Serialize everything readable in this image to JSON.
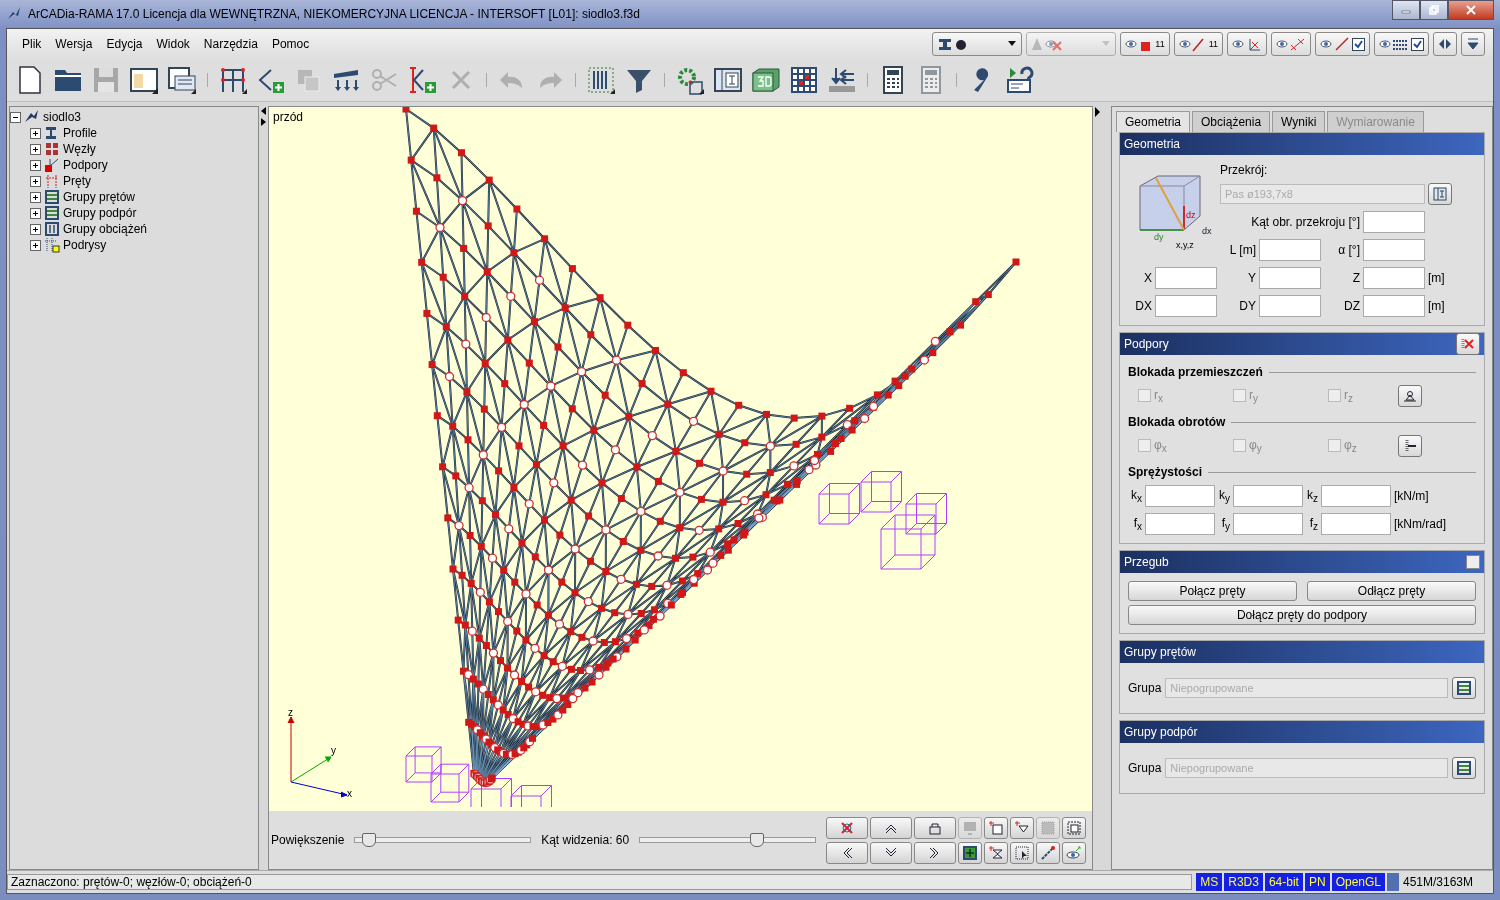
{
  "window": {
    "title": "ArCADia-RAMA 17.0 Licencja dla WEWNĘTRZNA, NIEKOMERCYJNA LICENCJA - INTERSOFT [L01]: siodlo3.f3d"
  },
  "menu": [
    {
      "label": "Plik"
    },
    {
      "label": "Wersja"
    },
    {
      "label": "Edycja"
    },
    {
      "label": "Widok"
    },
    {
      "label": "Narzędzia"
    },
    {
      "label": "Pomoc"
    }
  ],
  "view_controls": [
    {
      "kind": "section-dropdown",
      "disabled": false
    },
    {
      "kind": "cone-dropdown",
      "disabled": true
    },
    {
      "kind": "eye-node",
      "label": "11"
    },
    {
      "kind": "eye-bar",
      "label": "11"
    },
    {
      "kind": "eye-axes",
      "on": false
    },
    {
      "kind": "eye-dimension",
      "on": false
    },
    {
      "kind": "eye-bar-check",
      "checked": true
    },
    {
      "kind": "eye-grid-check",
      "checked": true
    },
    {
      "kind": "split"
    },
    {
      "kind": "collapse"
    }
  ],
  "toolbar": [
    {
      "kind": "page",
      "disabled": false
    },
    {
      "kind": "folder",
      "disabled": false
    },
    {
      "kind": "floppy",
      "disabled": true
    },
    {
      "kind": "window",
      "disabled": false
    },
    {
      "kind": "document",
      "disabled": false
    },
    {
      "kind": "separator"
    },
    {
      "kind": "frame",
      "disabled": false
    },
    {
      "kind": "node-add",
      "disabled": false
    },
    {
      "kind": "copy",
      "disabled": true
    },
    {
      "kind": "load",
      "disabled": false
    },
    {
      "kind": "scissors",
      "disabled": true
    },
    {
      "kind": "bar-add",
      "disabled": false
    },
    {
      "kind": "cross",
      "disabled": true
    },
    {
      "kind": "separator"
    },
    {
      "kind": "undo",
      "disabled": true
    },
    {
      "kind": "redo",
      "disabled": true
    },
    {
      "kind": "separator"
    },
    {
      "kind": "columns",
      "disabled": false
    },
    {
      "kind": "funnel",
      "disabled": false
    },
    {
      "kind": "separator"
    },
    {
      "kind": "gear",
      "disabled": false
    },
    {
      "kind": "table",
      "disabled": false
    },
    {
      "kind": "cube3d",
      "disabled": false
    },
    {
      "kind": "grid",
      "disabled": false
    },
    {
      "kind": "arrows",
      "disabled": false
    },
    {
      "kind": "separator"
    },
    {
      "kind": "calculator",
      "disabled": false
    },
    {
      "kind": "calculator",
      "disabled": true
    },
    {
      "kind": "separator"
    },
    {
      "kind": "wrench",
      "disabled": false
    },
    {
      "kind": "help",
      "disabled": false
    }
  ],
  "tree": {
    "label": "siodlo3",
    "kind": "model",
    "expanded": true,
    "children": [
      {
        "label": "Profile",
        "kind": "profile",
        "expanded": false
      },
      {
        "label": "Węzły",
        "kind": "nodes",
        "expanded": false
      },
      {
        "label": "Podpory",
        "kind": "supports",
        "expanded": false
      },
      {
        "label": "Pręty",
        "kind": "bars",
        "expanded": false
      },
      {
        "label": "Grupy prętów",
        "kind": "groups",
        "expanded": false
      },
      {
        "label": "Grupy podpór",
        "kind": "groups",
        "expanded": false
      },
      {
        "label": "Grupy obciążeń",
        "kind": "load-groups",
        "expanded": false
      },
      {
        "label": "Podrysy",
        "kind": "sublayouts",
        "expanded": false
      }
    ]
  },
  "viewport": {
    "view_label": "przód",
    "axes": [
      "z",
      "y",
      "x"
    ],
    "zoom": {
      "label": "Powiększenie",
      "level": 0.07
    },
    "angle": {
      "label": "Kąt widzenia: 60",
      "level": 0.66
    },
    "nav_rows": [
      {
        "buttons": [
          {
            "kind": "no-rotate"
          },
          {
            "kind": "up"
          },
          {
            "kind": "lock"
          },
          {
            "kind": "screen",
            "disabled": true
          },
          {
            "kind": "add-node"
          },
          {
            "kind": "add-support"
          },
          {
            "kind": "hatch",
            "disabled": true
          },
          {
            "kind": "frame"
          }
        ]
      },
      {
        "buttons": [
          {
            "kind": "left"
          },
          {
            "kind": "down"
          },
          {
            "kind": "right"
          },
          {
            "kind": "fit"
          },
          {
            "kind": "add-hinge"
          },
          {
            "kind": "select"
          },
          {
            "kind": "line"
          },
          {
            "kind": "eye-rotate"
          }
        ]
      }
    ]
  },
  "tabs": [
    {
      "label": "Geometria",
      "selected": true,
      "disabled": false
    },
    {
      "label": "Obciążenia",
      "selected": false,
      "disabled": false
    },
    {
      "label": "Wyniki",
      "selected": false,
      "disabled": false
    },
    {
      "label": "Wymiarowanie",
      "selected": false,
      "disabled": true
    }
  ],
  "geometry": {
    "title": "Geometria",
    "cube_labels": [
      "dz",
      "dx",
      "dy",
      "x,y,z"
    ],
    "section_label": "Przekrój:",
    "section_value": "Pas ø193,7x8",
    "rotation_label": "Kąt obr. przekroju [°]",
    "length_label": "L [m]",
    "alpha_label": "α [°]",
    "coords": [
      {
        "labels": [
          "X",
          "Y",
          "Z"
        ],
        "unit": "[m]"
      },
      {
        "labels": [
          "DX",
          "DY",
          "DZ"
        ],
        "unit": "[m]"
      }
    ]
  },
  "supports": {
    "title": "Podpory",
    "groups": [
      {
        "title": "Blokada przemieszczeń",
        "kind": "support",
        "checks": [
          {
            "label": "r$_{x}$",
            "checked": false
          },
          {
            "label": "r$_{y}$",
            "checked": false
          },
          {
            "label": "r$_{z}$",
            "checked": false
          }
        ]
      },
      {
        "title": "Blokada obrotów",
        "kind": "fixed",
        "checks": [
          {
            "label": "φ$_{x}$",
            "checked": false
          },
          {
            "label": "φ$_{y}$",
            "checked": false
          },
          {
            "label": "φ$_{z}$",
            "checked": false
          }
        ]
      }
    ],
    "springs_title": "Sprężystości",
    "springs": [
      {
        "labels": [
          "k$_{x}$",
          "k$_{y}$",
          "k$_{z}$"
        ],
        "unit": "[kN/m]"
      },
      {
        "labels": [
          "f$_{x}$",
          "f$_{y}$",
          "f$_{z}$"
        ],
        "unit": "[kNm/rad]"
      }
    ]
  },
  "hinge": {
    "title": "Przegub",
    "checked": false,
    "buttons": [
      "Połącz pręty",
      "Odłącz pręty",
      "Dołącz pręty do podpory"
    ]
  },
  "bar_groups": {
    "title": "Grupy prętów",
    "label": "Grupa",
    "placeholder": "Niepogrupowane"
  },
  "support_groups": {
    "title": "Grupy podpór",
    "label": "Grupa",
    "placeholder": "Niepogrupowane"
  },
  "status_bar": {
    "text": "Zaznaczono: prętów-0; węzłów-0; obciążeń-0",
    "badges": [
      "MS",
      "R3D3",
      "64-bit",
      "PN",
      "OpenGL"
    ],
    "memory": "451M/3163M"
  }
}
